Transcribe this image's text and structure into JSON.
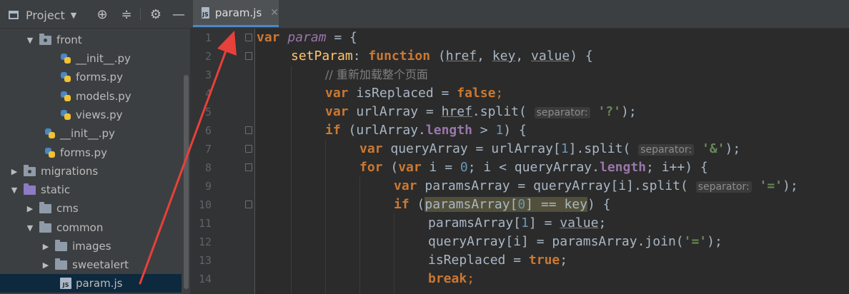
{
  "project_panel": {
    "title": "Project",
    "tree": [
      {
        "label": "front",
        "kind": "package",
        "expanded": true
      },
      {
        "label": "__init__.py",
        "kind": "python"
      },
      {
        "label": "forms.py",
        "kind": "python"
      },
      {
        "label": "models.py",
        "kind": "python"
      },
      {
        "label": "views.py",
        "kind": "python"
      },
      {
        "label": "__init__.py",
        "kind": "python"
      },
      {
        "label": "forms.py",
        "kind": "python"
      },
      {
        "label": "migrations",
        "kind": "package",
        "expanded": false
      },
      {
        "label": "static",
        "kind": "folder",
        "expanded": true
      },
      {
        "label": "cms",
        "kind": "folder",
        "expanded": false
      },
      {
        "label": "common",
        "kind": "folder",
        "expanded": true
      },
      {
        "label": "images",
        "kind": "folder",
        "expanded": false
      },
      {
        "label": "sweetalert",
        "kind": "folder",
        "expanded": false
      },
      {
        "label": "param.js",
        "kind": "javascript",
        "selected": true
      }
    ]
  },
  "editor": {
    "active_tab": "param.js",
    "line_numbers": [
      "1",
      "2",
      "3",
      "4",
      "5",
      "6",
      "7",
      "8",
      "9",
      "10",
      "11",
      "12",
      "13",
      "14"
    ],
    "code": {
      "l1": {
        "kw": "var",
        "name": "param",
        "rest": " = {"
      },
      "l2": {
        "name": "setParam",
        "sep": ": ",
        "kw": "function",
        "open": " (",
        "p1": "href",
        "c1": ", ",
        "p2": "key",
        "c2": ", ",
        "p3": "value",
        "close": ") {"
      },
      "l3": {
        "comment": "// 重新加载整个页面"
      },
      "l4": {
        "kw": "var",
        "a": " isReplaced = ",
        "val": "false",
        "end": ";"
      },
      "l5": {
        "kw": "var",
        "a": " urlArray = ",
        "obj": "href",
        "call": ".split(",
        "hint": "separator:",
        "str": "'?'",
        "end": ");"
      },
      "l6": {
        "kw": "if",
        "a": " (urlArray.",
        "prop": "length",
        "b": " > ",
        "num": "1",
        "end": ") {"
      },
      "l7": {
        "kw": "var",
        "a": " queryArray = urlArray[",
        "num": "1",
        "call": "].split(",
        "hint": "separator:",
        "str": "'&'",
        "end": ");"
      },
      "l8": {
        "kw": "for",
        "a": " (",
        "kw2": "var",
        "b": " i = ",
        "num": "0",
        "c": "; i < queryArray.",
        "prop": "length",
        "end": "; i++) {"
      },
      "l9": {
        "kw": "var",
        "a": " paramsArray = queryArray[i].split(",
        "hint": "separator:",
        "str": "'='",
        "end": ");"
      },
      "l10": {
        "kw": "if",
        "a": " (",
        "hl1": "paramsArray[",
        "num": "0",
        "hl2": "] == key",
        "end": ") {"
      },
      "l11": {
        "a": "paramsArray[",
        "num": "1",
        "b": "] = ",
        "p": "value",
        "end": ";"
      },
      "l12": {
        "a": "queryArray[i] = paramsArray.join(",
        "str": "'='",
        "end": ");"
      },
      "l13": {
        "a": "isReplaced = ",
        "val": "true",
        "end": ";"
      },
      "l14": {
        "kw": "break",
        "end": ";"
      }
    }
  },
  "colors": {
    "keyword": "#cc7832",
    "function_name": "#ffc66d",
    "string": "#6a8759",
    "number": "#6897bb",
    "comment": "#808080",
    "annotation_arrow": "#e8403a"
  },
  "icons": [
    "project-icon",
    "crosshair-icon",
    "collapse-icon",
    "gear-icon",
    "minimize-icon",
    "folder-icon",
    "python-file-icon",
    "js-file-icon"
  ]
}
